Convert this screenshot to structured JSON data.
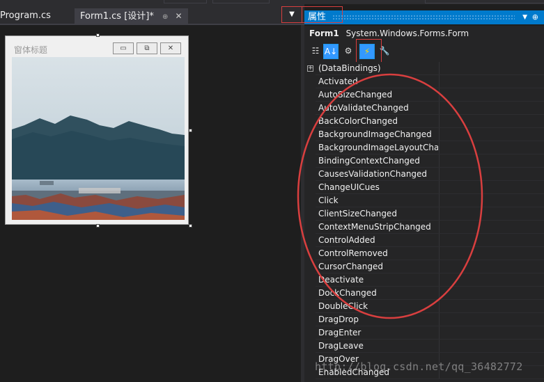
{
  "tabs": [
    {
      "label": "Program.cs",
      "active": false
    },
    {
      "label": "Form1.cs [设计]*",
      "active": true
    }
  ],
  "form": {
    "title": "窗体标题",
    "buttons": {
      "minimize": "▭",
      "maximize": "⧉",
      "close": "✕"
    }
  },
  "properties": {
    "title": "属性",
    "object_name": "Form1",
    "object_type": "System.Windows.Forms.Form",
    "events": [
      {
        "name": "(DataBindings)",
        "expandable": true
      },
      {
        "name": "Activated"
      },
      {
        "name": "AutoSizeChanged"
      },
      {
        "name": "AutoValidateChanged"
      },
      {
        "name": "BackColorChanged"
      },
      {
        "name": "BackgroundImageChanged"
      },
      {
        "name": "BackgroundImageLayoutChanged"
      },
      {
        "name": "BindingContextChanged"
      },
      {
        "name": "CausesValidationChanged"
      },
      {
        "name": "ChangeUICues"
      },
      {
        "name": "Click"
      },
      {
        "name": "ClientSizeChanged"
      },
      {
        "name": "ContextMenuStripChanged"
      },
      {
        "name": "ControlAdded"
      },
      {
        "name": "ControlRemoved"
      },
      {
        "name": "CursorChanged"
      },
      {
        "name": "Deactivate"
      },
      {
        "name": "DockChanged"
      },
      {
        "name": "DoubleClick"
      },
      {
        "name": "DragDrop"
      },
      {
        "name": "DragEnter"
      },
      {
        "name": "DragLeave"
      },
      {
        "name": "DragOver"
      },
      {
        "name": "EnabledChanged"
      }
    ]
  },
  "watermark": "http://blog.csdn.net/qq_36482772",
  "colors": {
    "accent": "#007acc",
    "annotation": "#d93f3f",
    "background": "#1e1e1e"
  }
}
